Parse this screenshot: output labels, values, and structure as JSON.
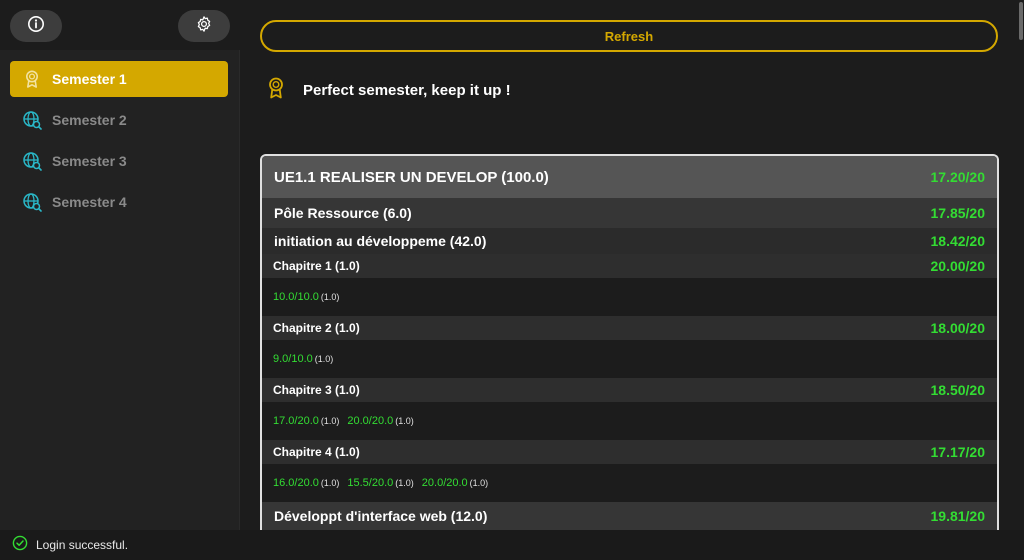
{
  "sidebar": {
    "top_icons": [
      "info-icon",
      "gear-icon"
    ],
    "items": [
      {
        "label": "Semester 1",
        "icon": "award-icon",
        "active": true
      },
      {
        "label": "Semester 2",
        "icon": "globe-search-icon",
        "active": false
      },
      {
        "label": "Semester 3",
        "icon": "globe-search-icon",
        "active": false
      },
      {
        "label": "Semester 4",
        "icon": "globe-search-icon",
        "active": false
      }
    ]
  },
  "main": {
    "refresh_label": "Refresh",
    "message": "Perfect semester, keep it up !",
    "ue": {
      "title": "UE1.1 REALISER UN DEVELOP (100.0)",
      "grade": "17.20/20",
      "poles": [
        {
          "title": "Pôle Ressource (6.0)",
          "grade": "17.85/20",
          "resources": [
            {
              "title": "initiation au développeme (42.0)",
              "grade": "18.42/20",
              "chapters": [
                {
                  "title": "Chapitre 1 (1.0)",
                  "grade": "20.00/20",
                  "marks": [
                    {
                      "value": "10.0/10.0",
                      "coef": "(1.0)"
                    }
                  ]
                },
                {
                  "title": "Chapitre 2 (1.0)",
                  "grade": "18.00/20",
                  "marks": [
                    {
                      "value": "9.0/10.0",
                      "coef": "(1.0)"
                    }
                  ]
                },
                {
                  "title": "Chapitre 3 (1.0)",
                  "grade": "18.50/20",
                  "marks": [
                    {
                      "value": "17.0/20.0",
                      "coef": "(1.0)"
                    },
                    {
                      "value": "20.0/20.0",
                      "coef": "(1.0)"
                    }
                  ]
                },
                {
                  "title": "Chapitre 4 (1.0)",
                  "grade": "17.17/20",
                  "marks": [
                    {
                      "value": "16.0/20.0",
                      "coef": "(1.0)"
                    },
                    {
                      "value": "15.5/20.0",
                      "coef": "(1.0)"
                    },
                    {
                      "value": "20.0/20.0",
                      "coef": "(1.0)"
                    }
                  ]
                }
              ]
            }
          ]
        },
        {
          "title": "Développt d'interface web (12.0)",
          "grade": "19.81/20"
        }
      ]
    }
  },
  "status": {
    "icon": "check-circle-icon",
    "text": "Login successful."
  },
  "colors": {
    "accent": "#d4a800",
    "grade_green": "#33dd33",
    "globe_teal": "#2ab8c8"
  }
}
